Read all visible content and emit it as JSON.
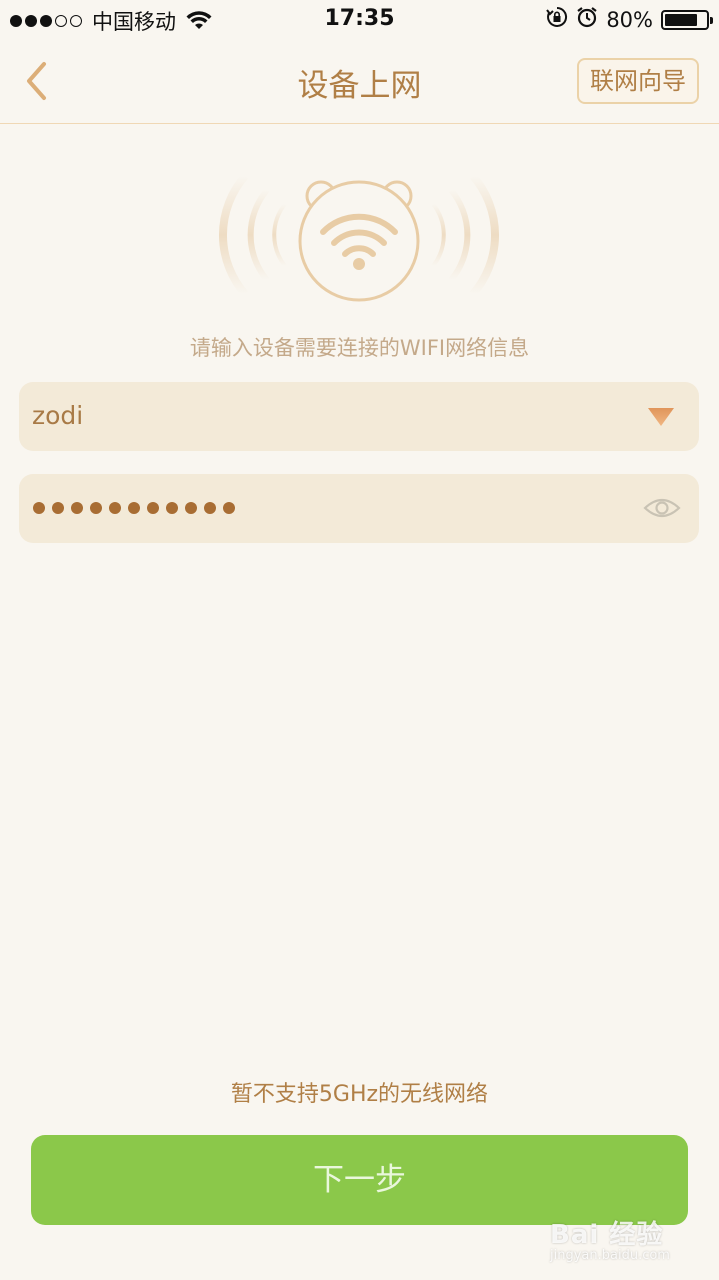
{
  "status_bar": {
    "carrier": "中国移动",
    "time": "17:35",
    "battery_percent": "80%",
    "battery_level": 0.8
  },
  "nav": {
    "title": "设备上网",
    "guide_label": "联网向导"
  },
  "form": {
    "instruction": "请输入设备需要连接的WIFI网络信息",
    "ssid_value": "zodi",
    "password_mask": "●●●●●●●●●●●"
  },
  "footer": {
    "note": "暂不支持5GHz的无线网络",
    "next_label": "下一步"
  },
  "watermark": {
    "text": "Bai 经验",
    "sub": "jingyan.baidu.com"
  },
  "colors": {
    "accent": "#b07f46",
    "button_green": "#8bc84a",
    "field_bg": "#f3ead8",
    "page_bg": "#f9f6f0"
  }
}
